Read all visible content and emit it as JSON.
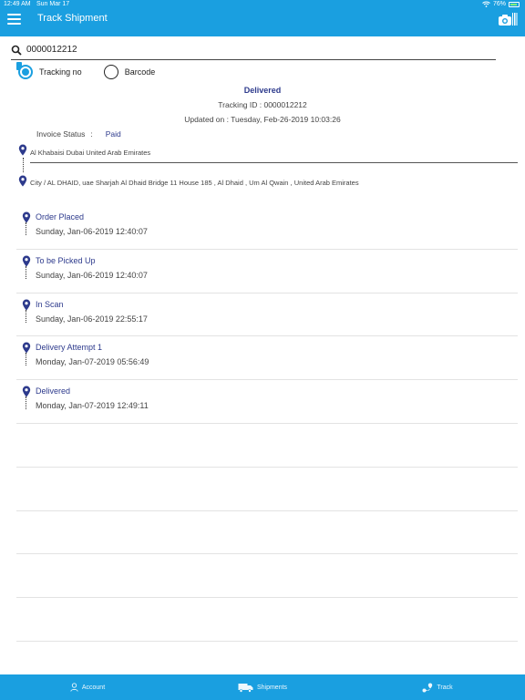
{
  "status_bar": {
    "time": "12:49 AM",
    "date": "Sun Mar 17",
    "battery": "76%"
  },
  "header": {
    "title": "Track Shipment",
    "menu_icon": "menu-icon",
    "camera_icon": "camera-icon"
  },
  "search": {
    "value": "0000012212",
    "icon": "search-icon"
  },
  "search_mode": {
    "selected": "Tracking no",
    "options": [
      {
        "label": "Tracking no"
      },
      {
        "label": "Barcode"
      }
    ]
  },
  "summary": {
    "status": "Delivered",
    "tracking_line": "Tracking ID : 0000012212",
    "updated_line": "Updated on : Tuesday, Feb-26-2019   10:03:26"
  },
  "invoice": {
    "label": "Invoice Status",
    "colon": ":",
    "value": "Paid"
  },
  "route": {
    "from": "Al Khabaisi Dubai United Arab Emirates",
    "to": "City  / AL DHAID, uae Sharjah Al Dhaid Bridge 11 House 185 , Al Dhaid , Um Al Qwain , United Arab Emirates"
  },
  "events": [
    {
      "title": "Order Placed",
      "time": "Sunday, Jan-06-2019    12:40:07"
    },
    {
      "title": "To be Picked Up",
      "time": "Sunday, Jan-06-2019    12:40:07"
    },
    {
      "title": "In Scan",
      "time": "Sunday, Jan-06-2019    22:55:17"
    },
    {
      "title": "Delivery Attempt 1",
      "time": "Monday, Jan-07-2019    05:56:49"
    },
    {
      "title": "Delivered",
      "time": "Monday, Jan-07-2019    12:49:11"
    }
  ],
  "bottom_nav": [
    {
      "label": "Account",
      "icon": "user-icon"
    },
    {
      "label": "Shipments",
      "icon": "truck-icon"
    },
    {
      "label": "Track",
      "icon": "route-icon"
    }
  ],
  "colors": {
    "primary": "#1a9fe0",
    "accent_text": "#2d3a8c"
  }
}
